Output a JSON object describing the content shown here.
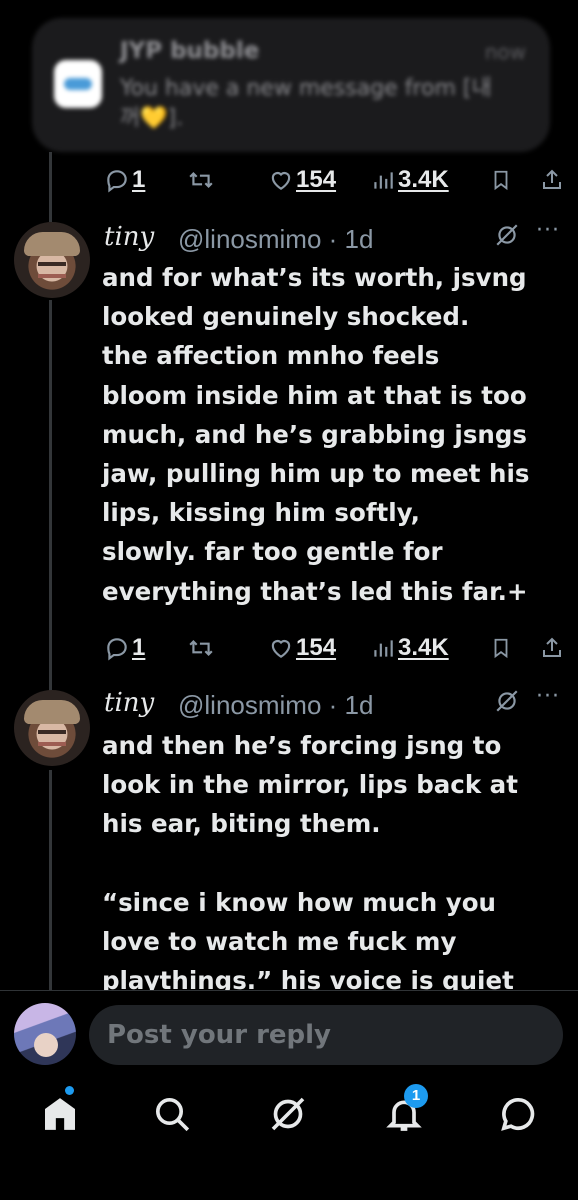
{
  "notification": {
    "app": "JYP bubble",
    "time": "now",
    "message": "You have a new message from [내꺼",
    "heart": "💛",
    "message_end": "]."
  },
  "tweets": [
    {
      "stats": {
        "replies": "1",
        "likes": "154",
        "views": "3.4K"
      }
    },
    {
      "name": "tiny",
      "handle": "@linosmimo · 1d",
      "text": "and for what’s its worth, jsvng\nlooked genuinely shocked.\nthe affection mnho feels\nbloom inside him at that is too\nmuch, and he’s grabbing jsngs\njaw, pulling him up to meet his\nlips, kissing him softly,\nslowly. far too gentle for\neverything that’s led this far.+",
      "stats": {
        "replies": "1",
        "likes": "154",
        "views": "3.4K"
      }
    },
    {
      "name": "tiny",
      "handle": "@linosmimo · 1d",
      "text": "and then he’s forcing jsng to\nlook in the mirror, lips back at\nhis ear, biting them.\n\n“since i know how much you\nlove to watch me fuck my\nplaythings.” his voice is quiet"
    }
  ],
  "reply": {
    "placeholder": "Post your reply"
  },
  "nav": {
    "icons": [
      "home-icon",
      "search-icon",
      "grok-icon",
      "notifications-icon",
      "messages-icon"
    ],
    "notification_count": "1"
  },
  "colors": {
    "accent": "#1d9bf0",
    "muted": "#8b98a5",
    "text": "#e7e9ea",
    "background": "#000000"
  }
}
